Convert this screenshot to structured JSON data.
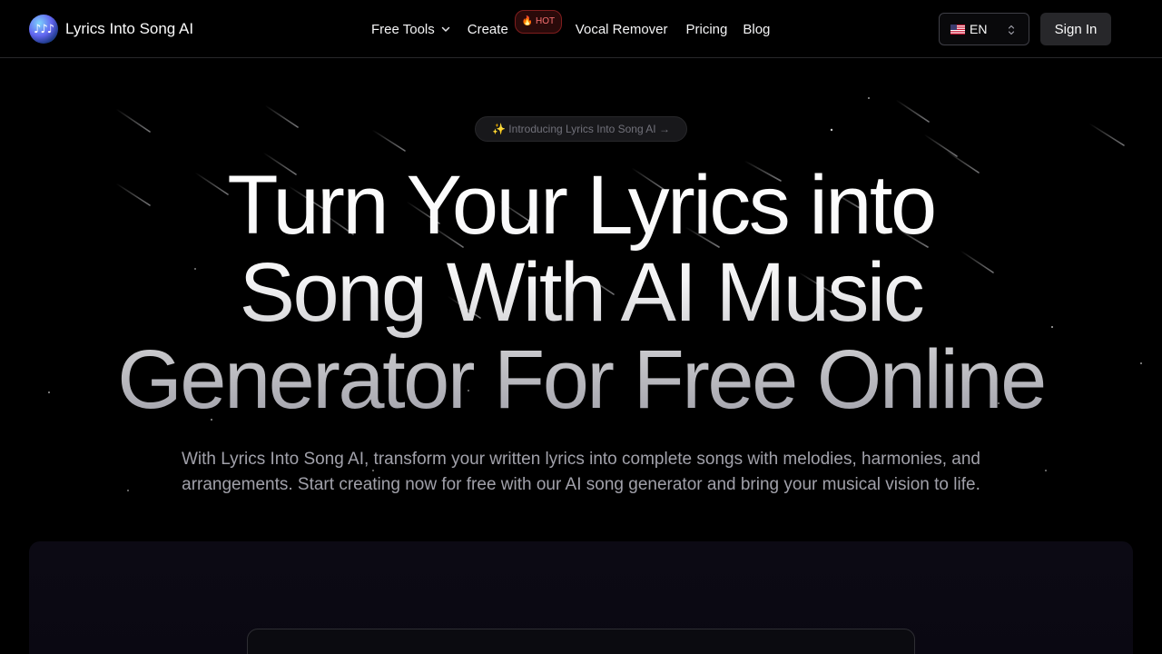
{
  "header": {
    "brand_name": "Lyrics Into Song AI",
    "logo_icon": "music-notes-logo",
    "nav": {
      "free_tools": "Free Tools",
      "create": "Create",
      "hot_badge": "🔥 HOT",
      "vocal_remover": "Vocal Remover",
      "pricing": "Pricing",
      "blog": "Blog"
    },
    "language": {
      "flag_icon": "us-flag-icon",
      "code": "EN"
    },
    "sign_in": "Sign In"
  },
  "hero": {
    "intro_pill": "✨ Introducing Lyrics Into Song AI →",
    "headline_lines": [
      "Turn Your Lyrics into",
      "Song With AI Music",
      "Generator For Free Online"
    ],
    "subtitle": "With Lyrics Into Song AI, transform your written lyrics into complete songs with melodies, harmonies, and arrangements. Start creating now for free with our AI song generator and bring your musical vision to life."
  },
  "colors": {
    "background": "#000000",
    "hot_badge_text": "#f87171",
    "hot_badge_border": "#7f1d1d",
    "subtitle_text": "#a1a1aa",
    "sign_in_bg": "#27272a"
  }
}
